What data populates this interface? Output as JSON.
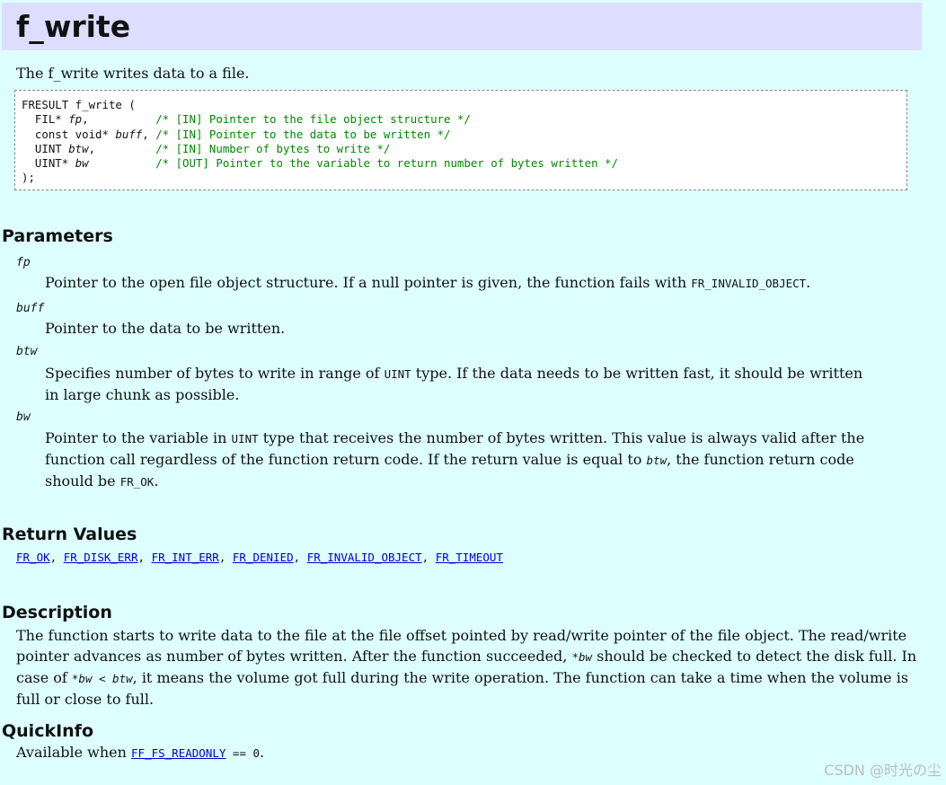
{
  "title": "f_write",
  "intro": "The f_write writes data to a file.",
  "prototype": {
    "line0": "FRESULT f_write (",
    "params": [
      {
        "type": "  FIL* ",
        "name": "fp",
        "sep": ",",
        "pad": "          ",
        "comment": "/* [IN] Pointer to the file object structure */"
      },
      {
        "type": "  const void* ",
        "name": "buff",
        "sep": ",",
        "pad": " ",
        "comment": "/* [IN] Pointer to the data to be written */"
      },
      {
        "type": "  UINT ",
        "name": "btw",
        "sep": ",",
        "pad": "         ",
        "comment": "/* [IN] Number of bytes to write */"
      },
      {
        "type": "  UINT* ",
        "name": "bw",
        "sep": "",
        "pad": "          ",
        "comment": "/* [OUT] Pointer to the variable to return number of bytes written */"
      }
    ],
    "close": ");"
  },
  "parameters": {
    "heading": "Parameters",
    "fp": {
      "name": "fp",
      "text1": "Pointer to the open file object structure. If a null pointer is given, the function fails with ",
      "code1": "FR_INVALID_OBJECT",
      "text2": "."
    },
    "buff": {
      "name": "buff",
      "text1": "Pointer to the data to be written."
    },
    "btw": {
      "name": "btw",
      "text1": "Specifies number of bytes to write in range of ",
      "code1": "UINT",
      "text2": " type. If the data needs to be written fast, it should be written in large chunk as possible."
    },
    "bw": {
      "name": "bw",
      "text1": "Pointer to the variable in ",
      "code1": "UINT",
      "text2": " type that receives the number of bytes written. This value is always valid after the function call regardless of the function return code. If the return value is equal to ",
      "code2": "btw",
      "text3": ", the function return code should be ",
      "code3": "FR_OK",
      "text4": "."
    }
  },
  "return_values": {
    "heading": "Return Values",
    "links": [
      "FR_OK",
      "FR_DISK_ERR",
      "FR_INT_ERR",
      "FR_DENIED",
      "FR_INVALID_OBJECT",
      "FR_TIMEOUT"
    ],
    "sep": ", "
  },
  "description": {
    "heading": "Description",
    "text1": "The function starts to write data to the file at the file offset pointed by read/write pointer of the file object. The read/write pointer advances as number of bytes written. After the function succeeded, ",
    "code1": "*bw",
    "text2": " should be checked to detect the disk full. In case of ",
    "code2": "*bw < btw",
    "text3": ", it means the volume got full during the write operation. The function can take a time when the volume is full or close to full."
  },
  "quickinfo": {
    "heading": "QuickInfo",
    "text1": "Available when ",
    "link": "FF_FS_READONLY",
    "code_tail": " == 0",
    "text2": "."
  },
  "watermark": "CSDN @时光の尘"
}
